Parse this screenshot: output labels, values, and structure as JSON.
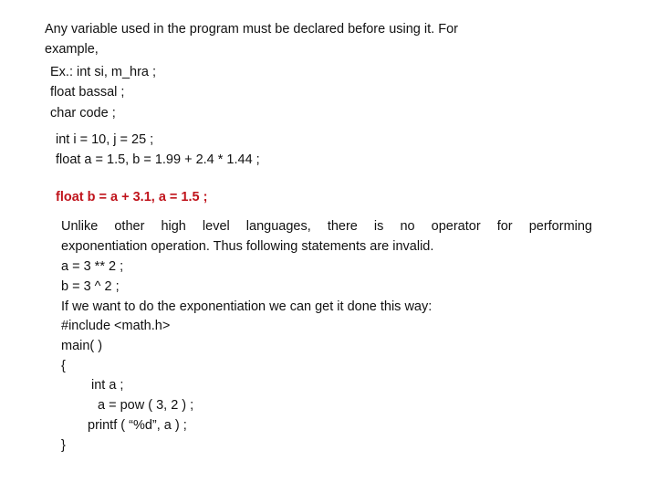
{
  "intro": {
    "line1": "Any variable used in the program must be declared before using it. For",
    "line2": "example,"
  },
  "example_decls": [
    "Ex.: int si, m_hra ;",
    "float bassal ;",
    "char code ;"
  ],
  "init_decls": [
    "int i = 10, j = 25 ;",
    "float a = 1.5, b = 1.99 + 2.4 * 1.44 ;"
  ],
  "invalid_decl": {
    "text": "float b = a + 3.1, a = 1.5 ;",
    "color": "#c0141c"
  },
  "exponent_section": {
    "para_line1": "Unlike other high level languages, there is no operator for performing",
    "para_line2": "exponentiation operation. Thus following statements are invalid.",
    "invalid_statements": [
      "a = 3 ** 2 ;",
      "b = 3 ^ 2 ;"
    ],
    "explanation": "If we want to do the exponentiation we can get it done this way:"
  },
  "code_sample": {
    "include": "#include <math.h>",
    "main": "main( )",
    "open_brace": "{",
    "decl": "int a ;",
    "assign": "a = pow ( 3, 2 ) ;",
    "print": "printf ( “%d”, a ) ;",
    "close_brace": "}"
  }
}
